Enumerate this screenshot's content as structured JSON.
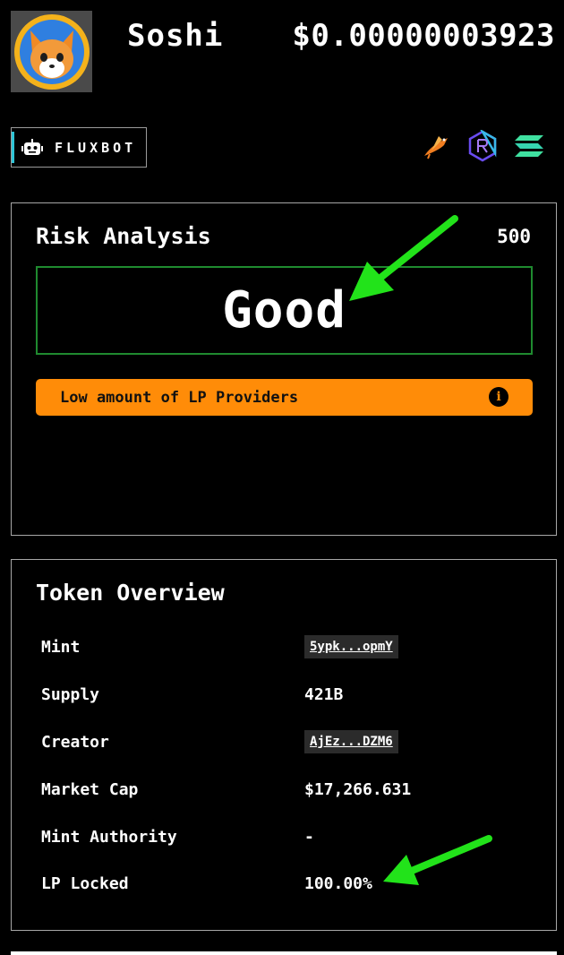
{
  "header": {
    "token_name": "Soshi",
    "token_price": "$0.00000003923",
    "avatar_icon": "shiba-fox-avatar-icon"
  },
  "toolbar": {
    "fluxbot_label": "FLUXBOT",
    "fluxbot_icon": "robot-icon",
    "external_icons": [
      "birdeye-icon",
      "raydium-icon",
      "solana-icon"
    ]
  },
  "risk": {
    "title": "Risk Analysis",
    "score": "500",
    "rating": "Good",
    "warning": "Low amount of LP Providers",
    "info_glyph": "i",
    "colors": {
      "rating_border": "#1f8a2f",
      "warning_bg": "#ff8c08"
    }
  },
  "overview": {
    "title": "Token Overview",
    "rows": [
      {
        "label": "Mint",
        "value": "5ypk...opmY"
      },
      {
        "label": "Supply",
        "value": "421B"
      },
      {
        "label": "Creator",
        "value": "AjEz...DZM6"
      },
      {
        "label": "Market Cap",
        "value": "$17,266.631"
      },
      {
        "label": "Mint Authority",
        "value": "-"
      },
      {
        "label": "LP Locked",
        "value": "100.00%"
      }
    ]
  },
  "annotations": {
    "arrow_color": "#22e31a"
  }
}
